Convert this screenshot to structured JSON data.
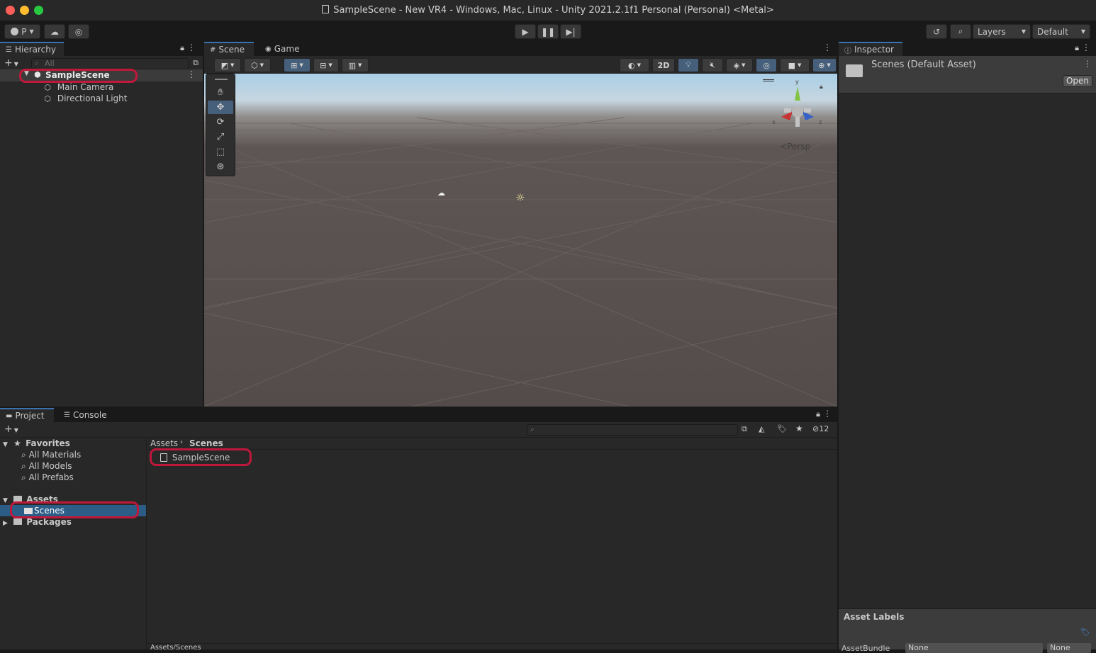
{
  "window": {
    "title": "SampleScene - New VR4 - Windows, Mac, Linux - Unity 2021.2.1f1 Personal (Personal) <Metal>",
    "colors": {
      "close": "#ff5f57",
      "minimize": "#febc2e",
      "zoom": "#28c840",
      "accent": "#3a72b0",
      "annotation": "#c0183a"
    }
  },
  "toolbar": {
    "account_label": "P",
    "layers_label": "Layers",
    "layout_label": "Default"
  },
  "hierarchy": {
    "tab_label": "Hierarchy",
    "search_placeholder": "All",
    "scene_name": "SampleScene",
    "items": [
      "Main Camera",
      "Directional Light"
    ]
  },
  "scene_view": {
    "tabs": [
      "Scene",
      "Game"
    ],
    "button_2d": "2D",
    "projection_label": "Persp",
    "gizmo_labels": {
      "x": "x",
      "y": "y",
      "z": "z"
    }
  },
  "inspector": {
    "tab_label": "Inspector",
    "asset_title": "Scenes (Default Asset)",
    "open_button": "Open",
    "asset_labels_title": "Asset Labels",
    "asset_bundle_label": "AssetBundle",
    "asset_bundle_value": "None",
    "asset_bundle_variant": "None"
  },
  "project": {
    "tabs": [
      "Project",
      "Console"
    ],
    "hidden_count": "12",
    "favorites_label": "Favorites",
    "favorites": [
      "All Materials",
      "All Models",
      "All Prefabs"
    ],
    "assets_label": "Assets",
    "assets_children": [
      "Scenes"
    ],
    "packages_label": "Packages",
    "breadcrumb": [
      "Assets",
      "Scenes"
    ],
    "files": [
      "SampleScene"
    ],
    "footer_path": "Assets/Scenes"
  }
}
